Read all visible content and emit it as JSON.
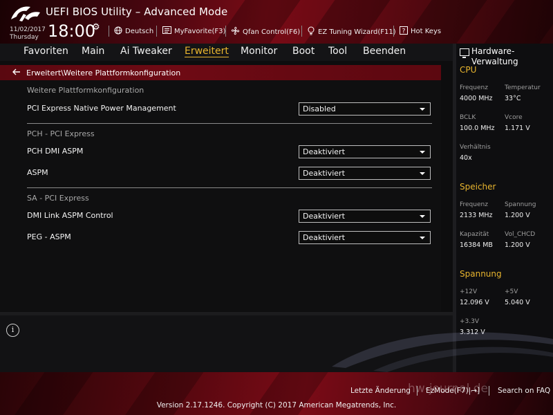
{
  "header": {
    "title": "UEFI BIOS Utility – Advanced Mode",
    "date": "11/02/2017",
    "weekday": "Thursday",
    "time": "18:00",
    "buttons": {
      "language": "Deutsch",
      "myfavorite": "MyFavorite(F3)",
      "qfan": "Qfan Control(F6)",
      "ez_tuning": "EZ Tuning Wizard(F11)",
      "hotkeys": "Hot Keys"
    }
  },
  "menu": {
    "items": [
      "Favoriten",
      "Main",
      "Ai Tweaker",
      "Erweitert",
      "Monitor",
      "Boot",
      "Tool",
      "Beenden"
    ],
    "active": "Erweitert"
  },
  "breadcrumb": "Erweitert\\Weitere Plattformkonfiguration",
  "main": {
    "section1_title": "Weitere Plattformkonfiguration",
    "opt_pci_native_pm": {
      "label": "PCI Express Native Power Management",
      "value": "Disabled"
    },
    "section2_title": "PCH - PCI Express",
    "opt_pch_dmi_aspm": {
      "label": "PCH DMI ASPM",
      "value": "Deaktiviert"
    },
    "opt_aspm": {
      "label": "ASPM",
      "value": "Deaktiviert"
    },
    "section3_title": "SA - PCI Express",
    "opt_dmi_link_aspm": {
      "label": "DMI Link ASPM Control",
      "value": "Deaktiviert"
    },
    "opt_peg_aspm": {
      "label": "PEG - ASPM",
      "value": "Deaktiviert"
    }
  },
  "hw_monitor": {
    "title": "Hardware-Verwaltung",
    "cpu": {
      "title": "CPU",
      "freq_label": "Frequenz",
      "freq_value": "4000 MHz",
      "temp_label": "Temperatur",
      "temp_value": "33°C",
      "bclk_label": "BCLK",
      "bclk_value": "100.0 MHz",
      "vcore_label": "Vcore",
      "vcore_value": "1.171 V",
      "ratio_label": "Verhältnis",
      "ratio_value": "40x"
    },
    "memory": {
      "title": "Speicher",
      "freq_label": "Frequenz",
      "freq_value": "2133 MHz",
      "volt_label": "Spannung",
      "volt_value": "1.200 V",
      "cap_label": "Kapazität",
      "cap_value": "16384 MB",
      "volchcd_label": "Vol_CHCD",
      "volchcd_value": "1.200 V"
    },
    "voltage": {
      "title": "Spannung",
      "v12_label": "+12V",
      "v12_value": "12.096 V",
      "v5_label": "+5V",
      "v5_value": "5.040 V",
      "v33_label": "+3.3V",
      "v33_value": "3.312 V"
    }
  },
  "footer": {
    "last_change": "Letzte Änderung",
    "ezmode": "EzMode(F7)|→]",
    "search": "Search on FAQ",
    "version": "Version 2.17.1246. Copyright (C) 2017 American Megatrends, Inc.",
    "watermark": "hw-journal.de"
  },
  "colors": {
    "accent": "#e9b52e",
    "brand_red": "#7a0b16"
  },
  "icons": [
    "rog-logo-icon",
    "gear-icon",
    "globe-icon",
    "favorite-list-icon",
    "fan-icon",
    "wizard-bulb-icon",
    "question-icon",
    "arrow-left-icon",
    "monitor-icon",
    "info-icon",
    "chevron-down-icon"
  ]
}
